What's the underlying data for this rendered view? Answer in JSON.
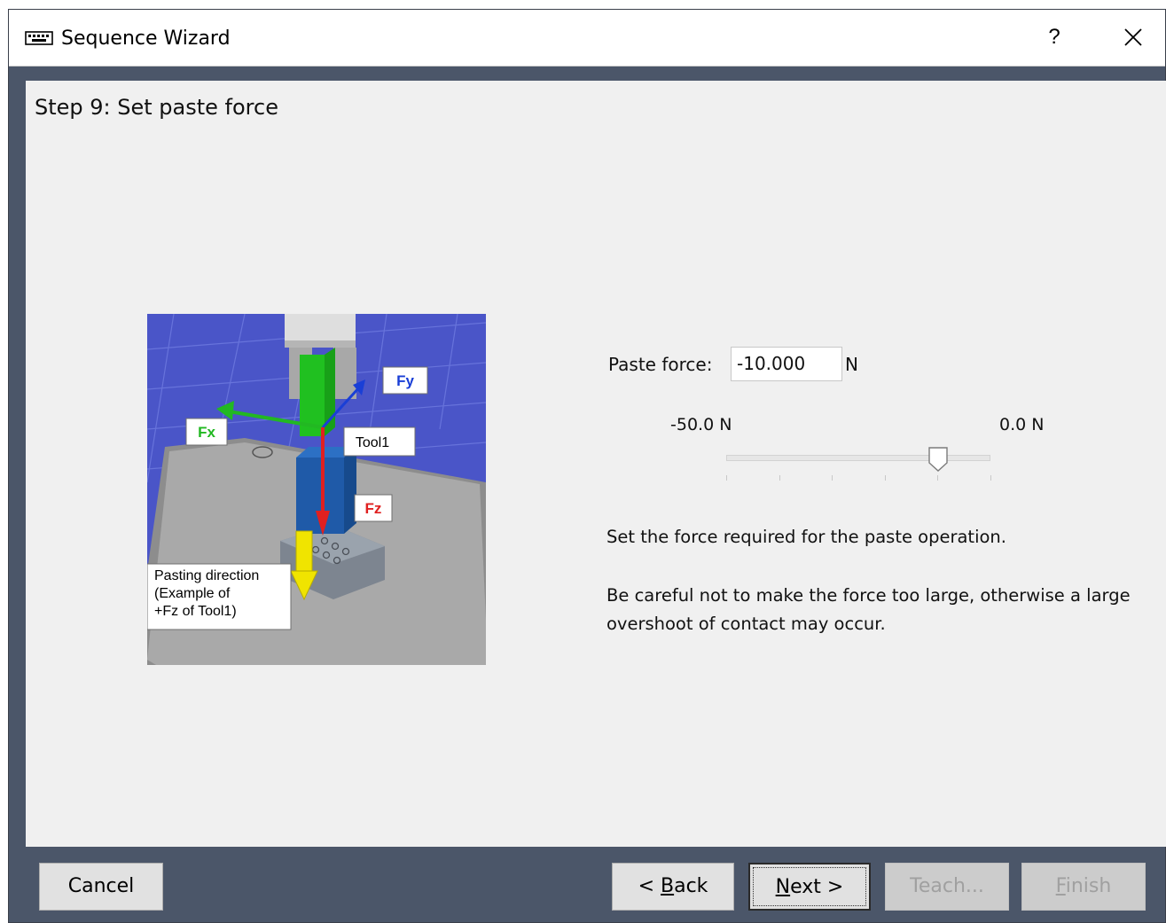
{
  "window": {
    "title": "Sequence Wizard",
    "help_glyph": "?",
    "icons": {
      "app": "keyboard-icon",
      "close": "close-icon"
    }
  },
  "step": {
    "title": "Step 9: Set paste force"
  },
  "illustration": {
    "labels": {
      "fy": "Fy",
      "fx": "Fx",
      "fz": "Fz",
      "tool": "Tool1",
      "pasting_line1": "Pasting direction",
      "pasting_line2": "(Example of",
      "pasting_line3": "+Fz of Tool1)"
    },
    "colors": {
      "floor": "#4a55c8",
      "block": "#1f5aa8",
      "fy": "#1a3fd6",
      "fx": "#22b822",
      "fz": "#e02020",
      "direction": "#f0e400"
    }
  },
  "force": {
    "label": "Paste force:",
    "value": "-10.000",
    "unit": "N",
    "range_min_label": "-50.0 N",
    "range_max_label": "0.0 N",
    "slider": {
      "min": -50.0,
      "max": 0.0,
      "value": -10.0
    }
  },
  "description": {
    "line1": "Set the force required for the paste operation.",
    "line2": "Be careful not to make the force too large, otherwise a large overshoot of contact may occur."
  },
  "buttons": {
    "cancel": {
      "label": "Cancel"
    },
    "back": {
      "prefix": "< ",
      "mnemonic": "B",
      "rest": "ack"
    },
    "next": {
      "mnemonic": "N",
      "rest": "ext >"
    },
    "teach": {
      "label": "Teach..."
    },
    "finish": {
      "mnemonic": "F",
      "rest": "inish"
    }
  }
}
